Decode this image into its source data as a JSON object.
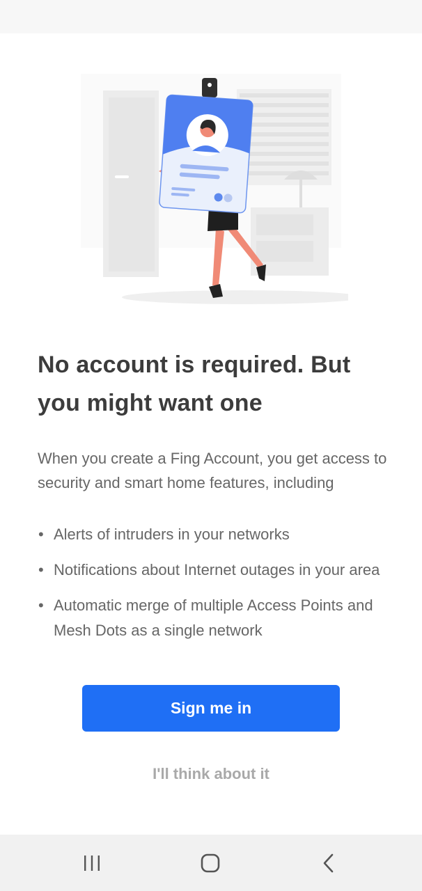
{
  "onboarding": {
    "headline": "No account is required. But you might want one",
    "intro": "When you create a Fing Account, you get access to security and smart home features, including",
    "features": [
      "Alerts of intruders in your networks",
      "Notifications about Internet outages in your area",
      "Automatic merge of multiple Access Points and Mesh Dots as a single network"
    ],
    "sign_in_label": "Sign me in",
    "skip_label": "I'll think about it"
  },
  "colors": {
    "accent": "#1f6ff5",
    "headline": "#3c3c3c",
    "body_text": "#666666",
    "secondary_text": "#a9a9a9"
  },
  "icons": {
    "illustration": "id-badge-woman-illustration",
    "nav_recents": "recents-icon",
    "nav_home": "home-icon",
    "nav_back": "back-icon"
  }
}
